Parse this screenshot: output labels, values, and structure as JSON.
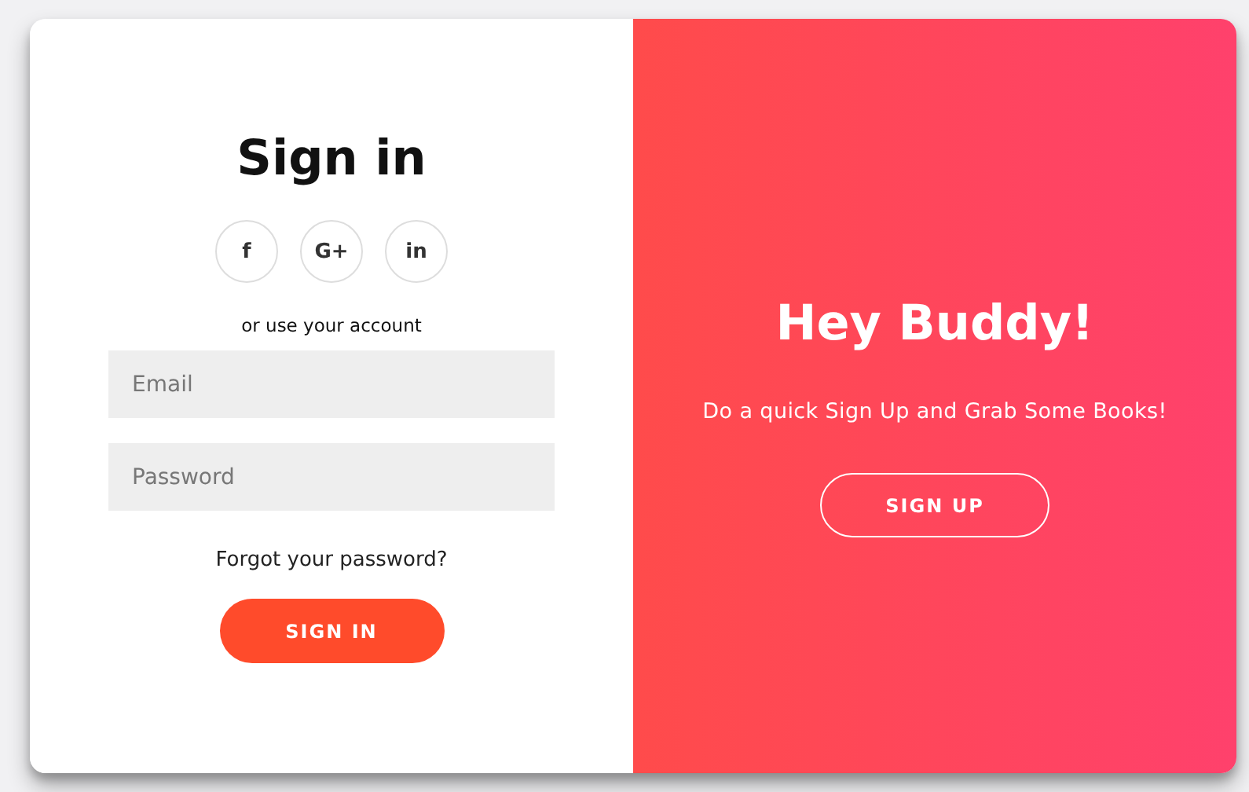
{
  "sign_in": {
    "title": "Sign in",
    "social_buttons": [
      "f",
      "G+",
      "in"
    ],
    "divider_text": "or use your account",
    "fields": [
      {
        "placeholder": "Email"
      },
      {
        "placeholder": "Password"
      }
    ],
    "forgot_link": "Forgot your password?",
    "button": "SIGN IN"
  },
  "overlay": {
    "title": "Hey Buddy!",
    "subtitle": "Do a quick Sign Up and Grab Some Books!",
    "button": "SIGN UP"
  }
}
